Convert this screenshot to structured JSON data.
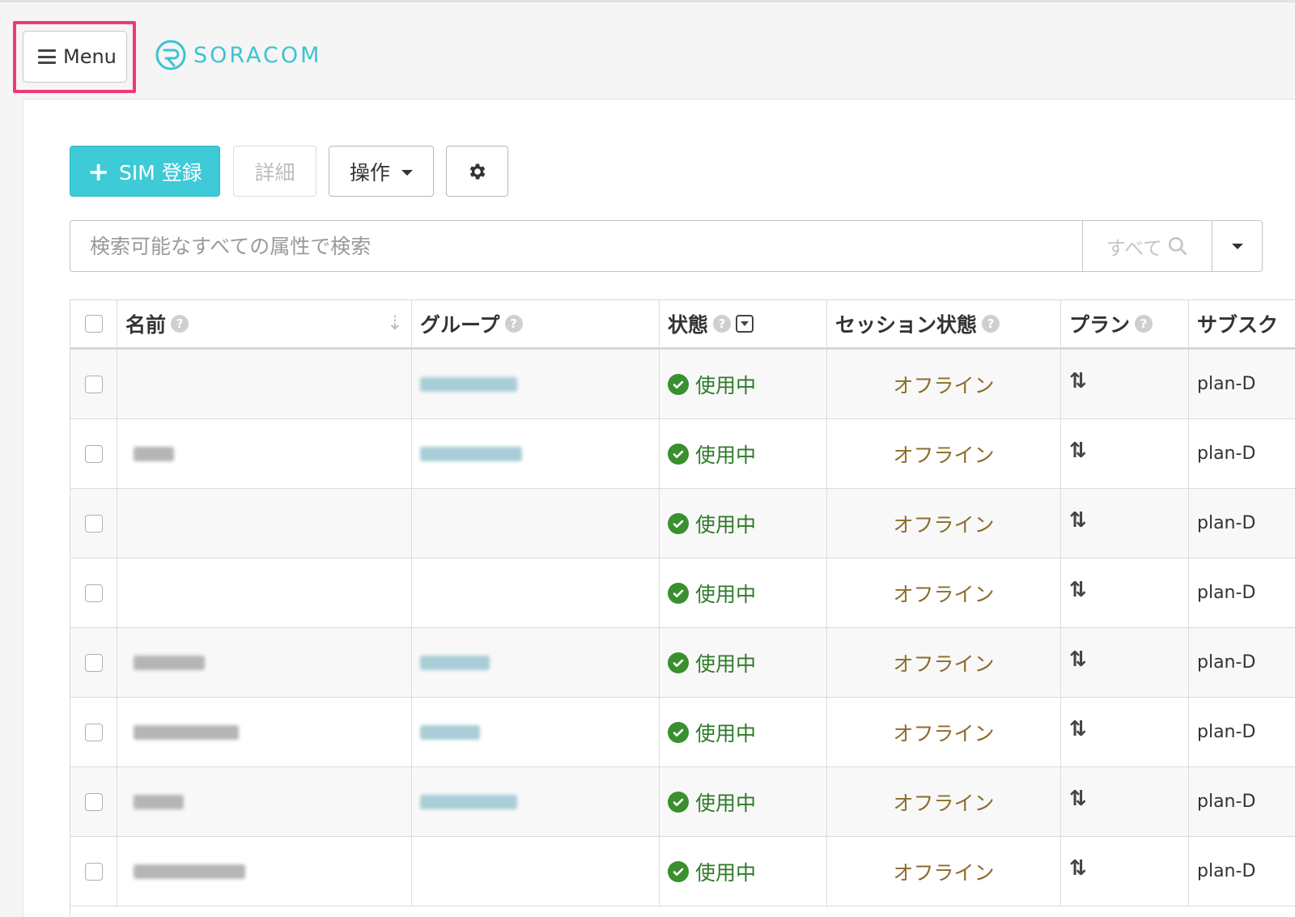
{
  "header": {
    "menu_label": "Menu",
    "logo_text": "SORACOM"
  },
  "toolbar": {
    "add_sim_label": "SIM 登録",
    "detail_label": "詳細",
    "operations_label": "操作"
  },
  "search": {
    "placeholder": "検索可能なすべての属性で検索",
    "scope_label": "すべて"
  },
  "table": {
    "columns": [
      {
        "key": "name",
        "label": "名前"
      },
      {
        "key": "group",
        "label": "グループ"
      },
      {
        "key": "status",
        "label": "状態"
      },
      {
        "key": "session",
        "label": "セッション状態"
      },
      {
        "key": "plan",
        "label": "プラン"
      },
      {
        "key": "subscription",
        "label": "サブスク"
      }
    ],
    "rows": [
      {
        "name": "",
        "group": "",
        "status": "使用中",
        "session": "オフライン",
        "plan": "⇅",
        "subscription": "plan-D"
      },
      {
        "name": "",
        "group": "",
        "status": "使用中",
        "session": "オフライン",
        "plan": "⇅",
        "subscription": "plan-D"
      },
      {
        "name": "",
        "group": "",
        "status": "使用中",
        "session": "オフライン",
        "plan": "⇅",
        "subscription": "plan-D"
      },
      {
        "name": "",
        "group": "",
        "status": "使用中",
        "session": "オフライン",
        "plan": "⇅",
        "subscription": "plan-D"
      },
      {
        "name": "",
        "group": "",
        "status": "使用中",
        "session": "オフライン",
        "plan": "⇅",
        "subscription": "plan-D"
      },
      {
        "name": "",
        "group": "",
        "status": "使用中",
        "session": "オフライン",
        "plan": "⇅",
        "subscription": "plan-D"
      },
      {
        "name": "",
        "group": "",
        "status": "使用中",
        "session": "オフライン",
        "plan": "⇅",
        "subscription": "plan-D"
      },
      {
        "name": "",
        "group": "",
        "status": "使用中",
        "session": "オフライン",
        "plan": "⇅",
        "subscription": "plan-D"
      }
    ]
  },
  "colors": {
    "accent": "#3ecad7",
    "highlight": "#ee3a76",
    "status_ok": "#2f7a2a",
    "session_offline": "#8a6d2b"
  }
}
